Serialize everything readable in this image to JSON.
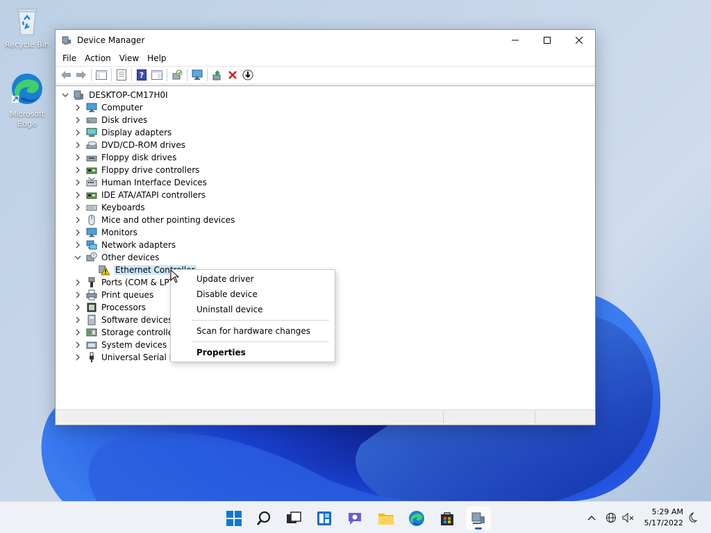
{
  "desktop": {
    "icons": [
      {
        "label": "Recycle Bin"
      },
      {
        "label_line1": "Microsoft",
        "label_line2": "Edge"
      }
    ]
  },
  "window": {
    "title": "Device Manager",
    "menu": [
      "File",
      "Action",
      "View",
      "Help"
    ],
    "root": "DESKTOP-CM17H0I",
    "categories": [
      "Computer",
      "Disk drives",
      "Display adapters",
      "DVD/CD-ROM drives",
      "Floppy disk drives",
      "Floppy drive controllers",
      "Human Interface Devices",
      "IDE ATA/ATAPI controllers",
      "Keyboards",
      "Mice and other pointing devices",
      "Monitors",
      "Network adapters",
      "Other devices",
      "Ports (COM & LPT)",
      "Print queues",
      "Processors",
      "Software devices",
      "Storage controllers",
      "System devices",
      "Universal Serial Bus"
    ],
    "child_device": "Ethernet Controller"
  },
  "context_menu": {
    "update": "Update driver",
    "disable": "Disable device",
    "uninstall": "Uninstall device",
    "scan": "Scan for hardware changes",
    "properties": "Properties"
  },
  "taskbar": {
    "time": "5:29 AM",
    "date": "5/17/2022"
  },
  "colors": {
    "accent": "#0a64c8",
    "selection": "#cce8ff",
    "uninstall_red": "#d21f1f"
  }
}
